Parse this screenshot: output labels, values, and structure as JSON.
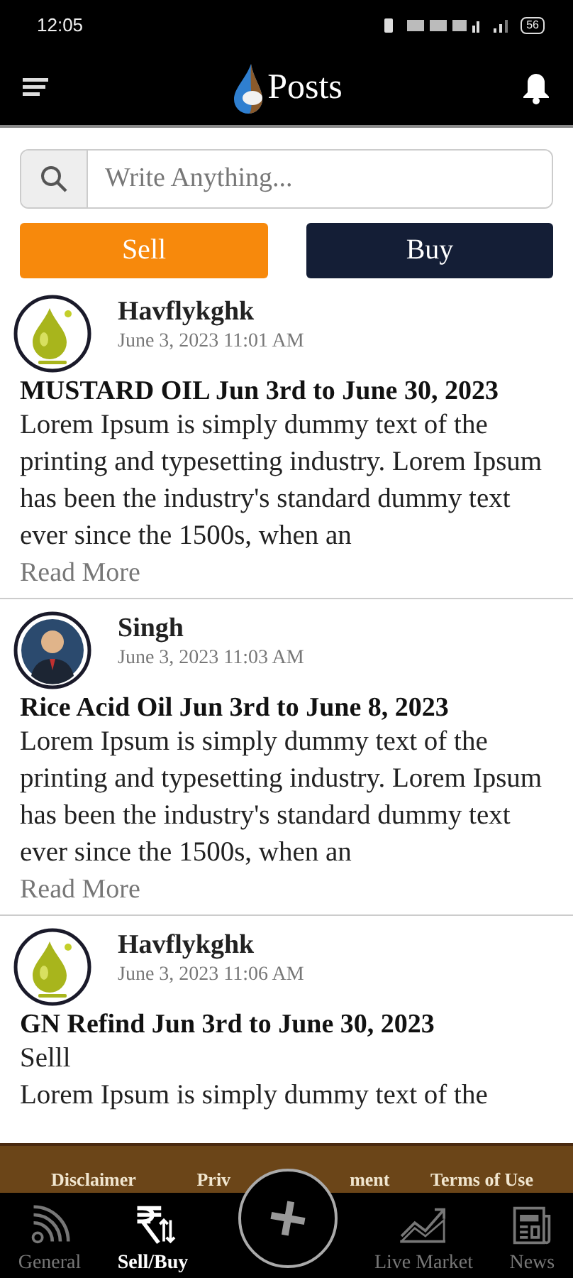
{
  "status_bar": {
    "time": "12:05",
    "battery": "56"
  },
  "header": {
    "title": "Posts"
  },
  "search": {
    "placeholder": "Write Anything..."
  },
  "actions": [
    "Sell",
    "Buy"
  ],
  "posts": [
    {
      "kind": "oil",
      "author": "Havflykghk",
      "date": "June 3, 2023 11:01 AM",
      "title": "MUSTARD OIL Jun 3rd to June 30, 2023",
      "body": "Lorem Ipsum is simply dummy text of the printing and typesetting industry. Lorem Ipsum has been the industry's standard dummy text ever since the 1500s, when an",
      "more": "Read More"
    },
    {
      "kind": "person",
      "author": "Singh",
      "date": "June 3, 2023 11:03 AM",
      "title": "Rice Acid Oil Jun 3rd to June 8, 2023",
      "body": "Lorem Ipsum is simply dummy text of the printing and typesetting industry. Lorem Ipsum has been the industry's standard dummy text ever since the 1500s, when an",
      "more": "Read More"
    },
    {
      "kind": "oil",
      "author": "Havflykghk",
      "date": "June 3, 2023 11:06 AM",
      "title": "GN Refind Jun 3rd to June 30, 2023",
      "subtitle": "Selll",
      "body": "Lorem Ipsum is simply dummy text of the"
    }
  ],
  "footer_links": [
    "Disclaimer",
    "Priv",
    "ment",
    "Terms of Use"
  ],
  "nav": [
    {
      "kind": "rss",
      "label": "General",
      "selected": false
    },
    {
      "kind": "rupee",
      "label": "Sell/Buy",
      "selected": true
    },
    {
      "kind": "chart",
      "label": "Live Market",
      "selected": false
    },
    {
      "kind": "news",
      "label": "News",
      "selected": false
    }
  ]
}
